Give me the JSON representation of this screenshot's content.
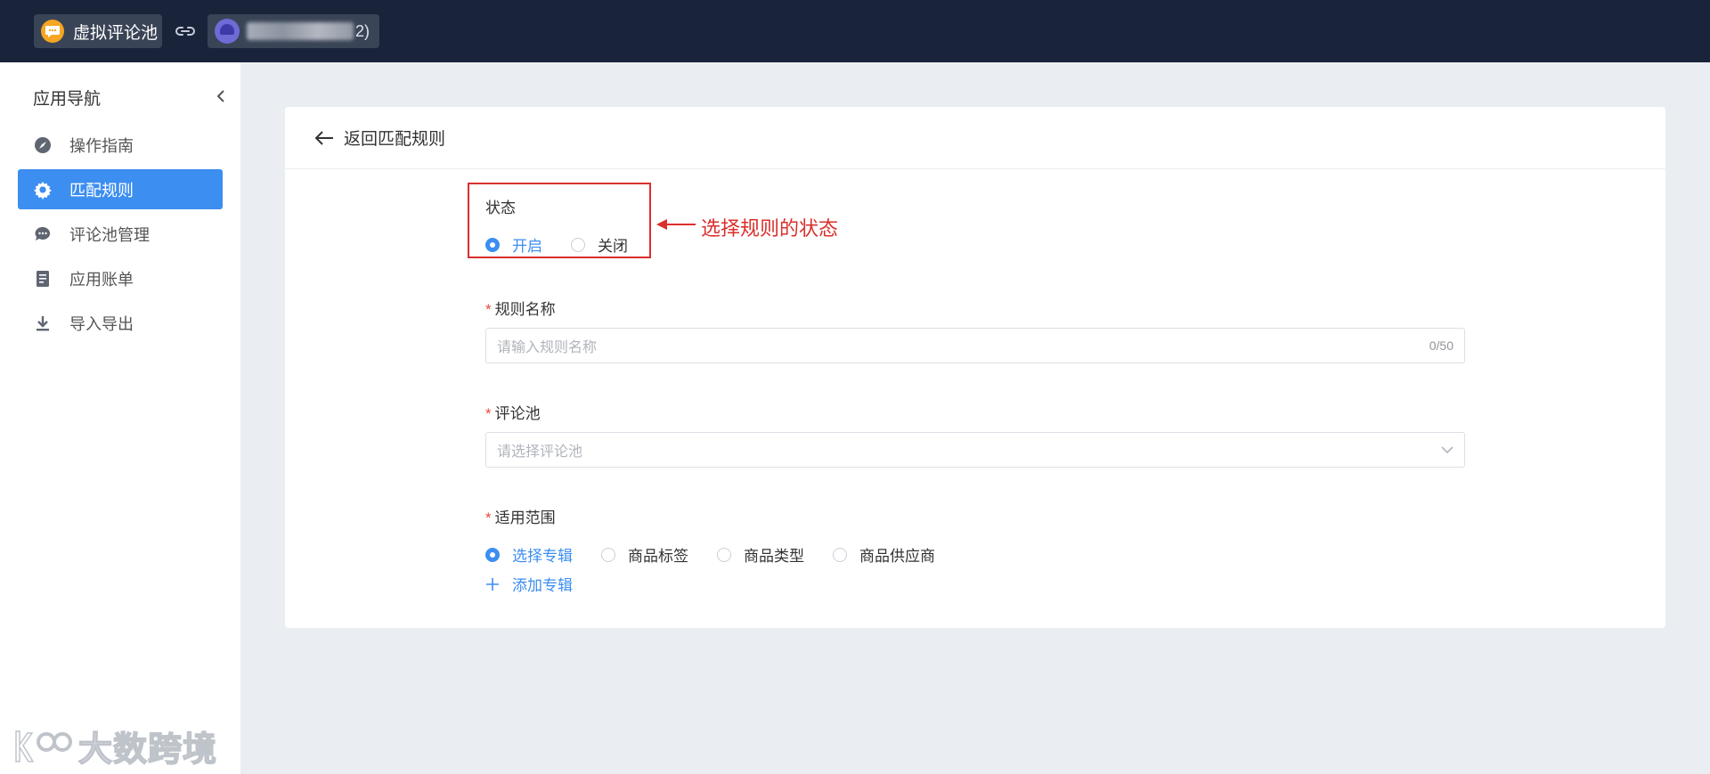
{
  "topbar": {
    "app_name": "虚拟评论池",
    "app_icon": "chat-bubble-icon",
    "link_icon": "link-icon",
    "store_name_suffix": "2)",
    "store_avatar_icon": "cloud-avatar-icon"
  },
  "sidebar": {
    "title": "应用导航",
    "collapse_icon": "chevron-left-icon",
    "items": [
      {
        "label": "操作指南",
        "icon": "compass-icon",
        "active": false
      },
      {
        "label": "匹配规则",
        "icon": "gear-icon",
        "active": true
      },
      {
        "label": "评论池管理",
        "icon": "comment-icon",
        "active": false
      },
      {
        "label": "应用账单",
        "icon": "bill-icon",
        "active": false
      },
      {
        "label": "导入导出",
        "icon": "download-icon",
        "active": false
      }
    ],
    "watermark": "大数跨境"
  },
  "page": {
    "back_label": "返回匹配规则",
    "status": {
      "label": "状态",
      "options": [
        "开启",
        "关闭"
      ],
      "selected": "开启"
    },
    "annotation": "选择规则的状态",
    "rule_name": {
      "label": "规则名称",
      "placeholder": "请输入规则名称",
      "counter": "0/50"
    },
    "comment_pool": {
      "label": "评论池",
      "placeholder": "请选择评论池"
    },
    "scope": {
      "label": "适用范围",
      "options": [
        "选择专辑",
        "商品标签",
        "商品类型",
        "商品供应商"
      ],
      "selected": "选择专辑",
      "add_label": "添加专辑"
    }
  },
  "colors": {
    "topbar": "#19233a",
    "accent": "#3c8ef0",
    "annotation": "#d9302c",
    "background": "#eaedf1"
  }
}
